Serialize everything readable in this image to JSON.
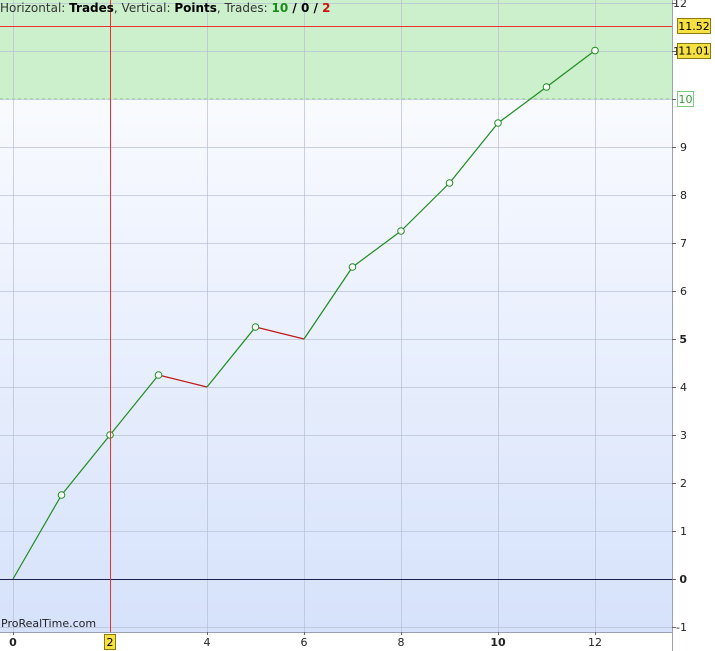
{
  "header": {
    "horizontal_label": "Horizontal:",
    "horizontal_value": "Trades",
    "vertical_label": ", Vertical:",
    "vertical_value": "Points",
    "trades_label": ", Trades:",
    "trades_winning": "10",
    "sep1": " / ",
    "trades_neutral": "0",
    "sep2": " / ",
    "trades_losing": "2"
  },
  "watermark": "ProRealTime.com",
  "colors": {
    "up": "#1e8c1e",
    "down": "#c01818",
    "zone_fill": "#ccf0cc",
    "zone_line": "#7fc87f",
    "bg_top": "#ffffff",
    "bg_bottom": "#d6e2fb",
    "grid": "#b8c0d4",
    "cursor": "#ee3030",
    "label_bg": "#f5e142",
    "zero_line": "#1a2050"
  },
  "chart_data": {
    "type": "line",
    "x": [
      0,
      1,
      2,
      3,
      4,
      5,
      6,
      7,
      8,
      9,
      10,
      11,
      12
    ],
    "y": [
      0,
      1.75,
      3.0,
      4.25,
      4.0,
      5.25,
      5.0,
      6.5,
      7.25,
      8.25,
      9.5,
      10.25,
      11.01
    ],
    "markers_on_trades": [
      1,
      2,
      3,
      5,
      7,
      8,
      9,
      10,
      11,
      12
    ],
    "xlim": [
      0,
      13.5
    ],
    "ylim": [
      -1,
      12
    ],
    "x_ticks": [
      0,
      2,
      4,
      6,
      8,
      10,
      12
    ],
    "x_ticks_bold": [
      0,
      10
    ],
    "y_ticks": [
      -1,
      0,
      1,
      2,
      3,
      4,
      5,
      6,
      7,
      8,
      9,
      10,
      11,
      12
    ],
    "y_ticks_bold": [
      0,
      5
    ],
    "highlight_zone_from": 10,
    "cursor_x": 2,
    "cursor_x_label": "2",
    "cursor_y": 11.52,
    "cursor_y_label": "11.52",
    "last_value_label": "11.01",
    "zone_label": "10",
    "grid": true
  }
}
